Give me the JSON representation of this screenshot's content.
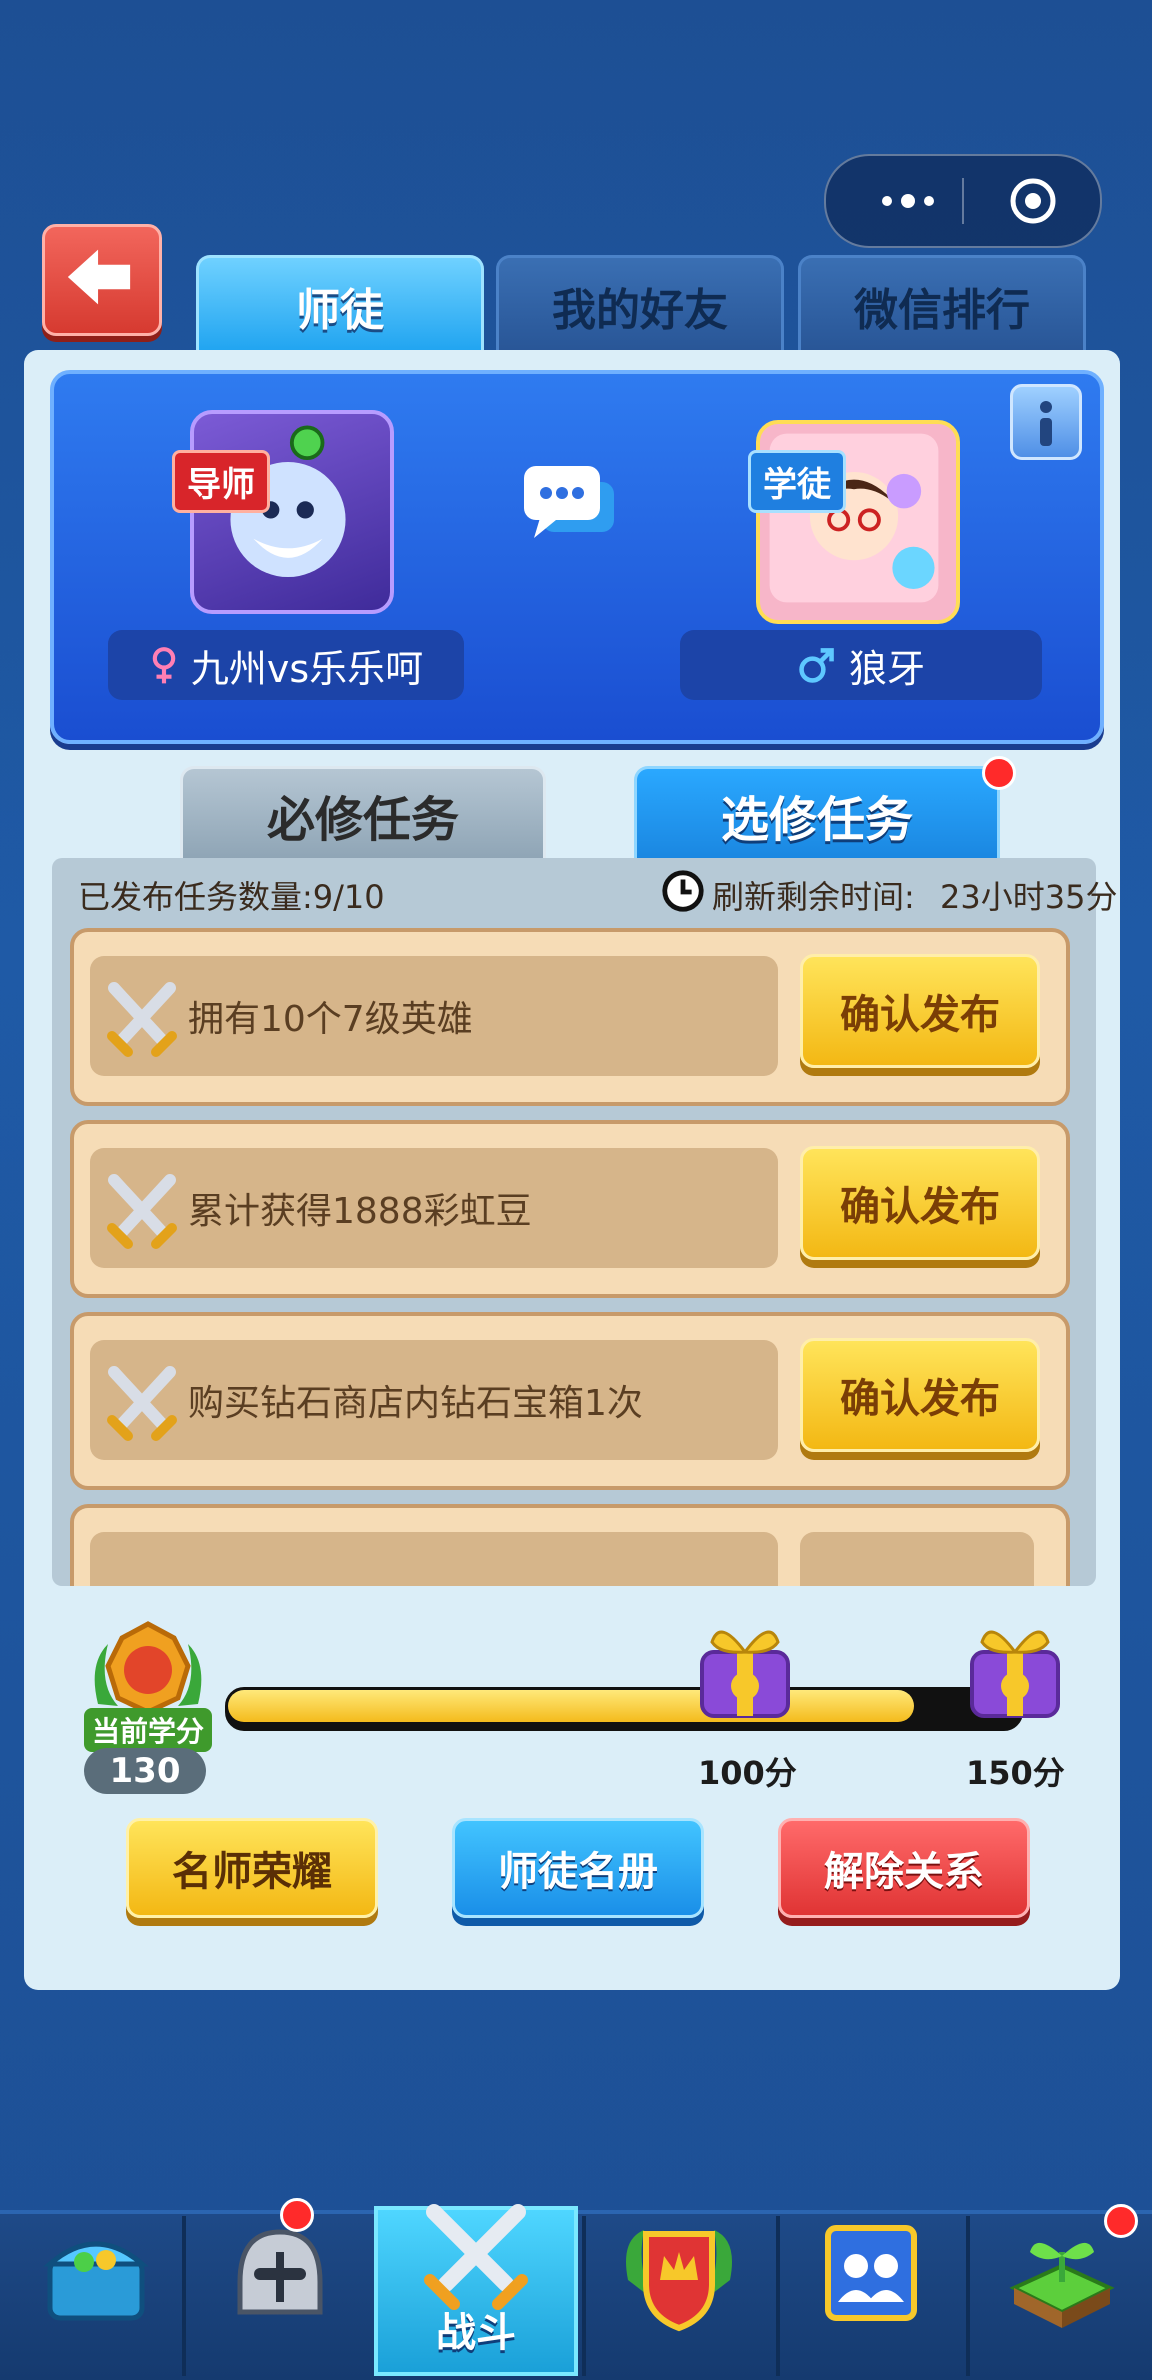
{
  "capsule": {
    "more_icon": "more-dots-icon",
    "close_icon": "target-circle-icon"
  },
  "tabs": [
    {
      "label": "师徒",
      "active": true
    },
    {
      "label": "我的好友",
      "active": false
    },
    {
      "label": "微信排行",
      "active": false
    }
  ],
  "mentor": {
    "tag": "导师",
    "name": "九州vs乐乐呵",
    "gender_icon": "female-icon"
  },
  "apprentice": {
    "tag": "学徒",
    "name": "狼牙",
    "gender_icon": "male-icon"
  },
  "segments": {
    "required": "必修任务",
    "elective": "选修任务"
  },
  "task_info": {
    "published": "已发布任务数量:9/10",
    "refresh_label": "刷新剩余时间:",
    "refresh_time": "23小时35分"
  },
  "tasks": [
    {
      "text": "拥有10个7级英雄",
      "button": "确认发布"
    },
    {
      "text": "累计获得1888彩虹豆",
      "button": "确认发布"
    },
    {
      "text": "购买钻石商店内钻石宝箱1次",
      "button": "确认发布"
    }
  ],
  "score": {
    "label": "当前学分",
    "value": "130",
    "progress_fraction": 0.866,
    "milestones": [
      {
        "label": "100分"
      },
      {
        "label": "150分"
      }
    ]
  },
  "buttons": {
    "honor": "名师荣耀",
    "roster": "师徒名册",
    "dissolve": "解除关系"
  },
  "nav": {
    "battle_label": "战斗"
  },
  "colors": {
    "accent_blue": "#1ea3f0",
    "gold": "#f3b814",
    "red": "#e84040"
  }
}
